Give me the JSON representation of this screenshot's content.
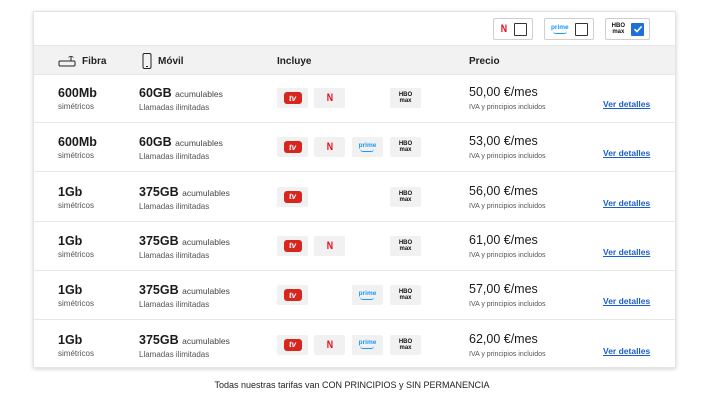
{
  "filters": [
    {
      "service": "netflix",
      "logo_text": "N",
      "checked": false
    },
    {
      "service": "prime",
      "logo_text": "prime",
      "checked": false
    },
    {
      "service": "hbo",
      "logo_text_top": "HBO",
      "logo_text_bottom": "max",
      "checked": true
    }
  ],
  "header": {
    "fibra": "Fibra",
    "movil": "Móvil",
    "incluye": "Incluye",
    "precio": "Precio",
    "fibra_icon": "router-icon",
    "movil_icon": "smartphone-icon"
  },
  "logos": {
    "tv": "tv",
    "netflix": "N",
    "prime": "prime",
    "hbo_top": "HBO",
    "hbo_bottom": "max"
  },
  "rows": [
    {
      "speed": "600Mb",
      "speed_sub": "simétricos",
      "data": "60GB",
      "data_sub": "acumulables",
      "calls": "Llamadas ilimitadas",
      "includes": [
        "tv",
        "netflix",
        "hbo"
      ],
      "price": "50,00 €/mes",
      "price_sub": "IVA y principios incluidos",
      "link": "Ver detalles"
    },
    {
      "speed": "600Mb",
      "speed_sub": "simétricos",
      "data": "60GB",
      "data_sub": "acumulables",
      "calls": "Llamadas ilimitadas",
      "includes": [
        "tv",
        "netflix",
        "prime",
        "hbo"
      ],
      "price": "53,00 €/mes",
      "price_sub": "IVA y principios incluidos",
      "link": "Ver detalles"
    },
    {
      "speed": "1Gb",
      "speed_sub": "simétricos",
      "data": "375GB",
      "data_sub": "acumulables",
      "calls": "Llamadas ilimitadas",
      "includes": [
        "tv",
        "hbo"
      ],
      "price": "56,00 €/mes",
      "price_sub": "IVA y principios incluidos",
      "link": "Ver detalles"
    },
    {
      "speed": "1Gb",
      "speed_sub": "simétricos",
      "data": "375GB",
      "data_sub": "acumulables",
      "calls": "Llamadas ilimitadas",
      "includes": [
        "tv",
        "netflix",
        "hbo"
      ],
      "price": "61,00 €/mes",
      "price_sub": "IVA y principios incluidos",
      "link": "Ver detalles"
    },
    {
      "speed": "1Gb",
      "speed_sub": "simétricos",
      "data": "375GB",
      "data_sub": "acumulables",
      "calls": "Llamadas ilimitadas",
      "includes": [
        "tv",
        "prime",
        "hbo"
      ],
      "price": "57,00 €/mes",
      "price_sub": "IVA y principios incluidos",
      "link": "Ver detalles"
    },
    {
      "speed": "1Gb",
      "speed_sub": "simétricos",
      "data": "375GB",
      "data_sub": "acumulables",
      "calls": "Llamadas ilimitadas",
      "includes": [
        "tv",
        "netflix",
        "prime",
        "hbo"
      ],
      "price": "62,00 €/mes",
      "price_sub": "IVA y principios incluidos",
      "link": "Ver detalles"
    }
  ],
  "footer": "Todas nuestras tarifas van CON PRINCIPIOS y SIN PERMANENCIA",
  "colors": {
    "accent": "#1e6fd9",
    "link": "#1a5fc8",
    "tv": "#d7261e",
    "netflix": "#e50914",
    "prime": "#1a98ff"
  }
}
